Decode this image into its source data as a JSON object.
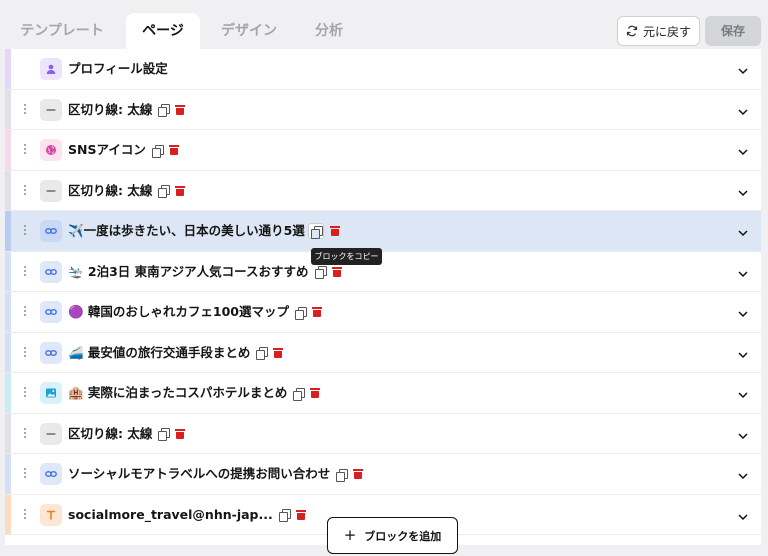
{
  "tabs": [
    {
      "label": "テンプレート",
      "active": false
    },
    {
      "label": "ページ",
      "active": true
    },
    {
      "label": "デザイン",
      "active": false
    },
    {
      "label": "分析",
      "active": false
    }
  ],
  "toolbar": {
    "reset_label": "元に戻す",
    "save_label": "保存"
  },
  "blocks": [
    {
      "label": "プロフィール設定",
      "icon": "person-icon",
      "icon_bg": "#ece4fb",
      "icon_color": "#8b5cf6",
      "strip": "#e3d7fb"
    },
    {
      "label": "区切り線: 太線",
      "icon": "divider-icon",
      "icon_bg": "#e9e9ec",
      "icon_color": "#6b6b70",
      "strip": "#e1e1e4"
    },
    {
      "label": "SNSアイコン",
      "icon": "globe-icon",
      "icon_bg": "#fbe3f0",
      "icon_color": "#d946a8",
      "strip": "#f8d9ea"
    },
    {
      "label": "区切り線: 太線",
      "icon": "divider-icon",
      "icon_bg": "#e9e9ec",
      "icon_color": "#6b6b70",
      "strip": "#e1e1e4"
    },
    {
      "label": "✈️一度は歩きたい、日本の美しい通り5選",
      "icon": "link-icon",
      "icon_bg": "#c9d8f5",
      "icon_color": "#3b6fd8",
      "strip": "#b9cdf2",
      "selected": true
    },
    {
      "label": "🛬 2泊3日 東南アジア人気コースおすすめ",
      "icon": "link-icon",
      "icon_bg": "#dfe8f9",
      "icon_color": "#3b6fd8",
      "strip": "#d3e0f7"
    },
    {
      "label": "🟣 韓国のおしゃれカフェ100選マップ",
      "icon": "link-icon",
      "icon_bg": "#dfe8f9",
      "icon_color": "#3b6fd8",
      "strip": "#d3e0f7"
    },
    {
      "label": "🚄 最安値の旅行交通手段まとめ",
      "icon": "link-icon",
      "icon_bg": "#dfe8f9",
      "icon_color": "#3b6fd8",
      "strip": "#d3e0f7"
    },
    {
      "label": "🏨 実際に泊まったコスパホテルまとめ",
      "icon": "image-icon",
      "icon_bg": "#d9f1fb",
      "icon_color": "#1aa3d9",
      "strip": "#cdeaf7"
    },
    {
      "label": "区切り線: 太線",
      "icon": "divider-icon",
      "icon_bg": "#e9e9ec",
      "icon_color": "#6b6b70",
      "strip": "#e1e1e4"
    },
    {
      "label": "ソーシャルモアトラベルへの提携お問い合わせ",
      "icon": "link-icon",
      "icon_bg": "#dfe8f9",
      "icon_color": "#3b6fd8",
      "strip": "#d3e0f7"
    },
    {
      "label": "socialmore_travel@nhn-jap...",
      "icon": "text-icon",
      "icon_bg": "#fde6d3",
      "icon_color": "#f07a1f",
      "strip": "#fbdcc3"
    }
  ],
  "tooltip": "ブロックをコピー",
  "add_block_label": "ブロックを追加"
}
